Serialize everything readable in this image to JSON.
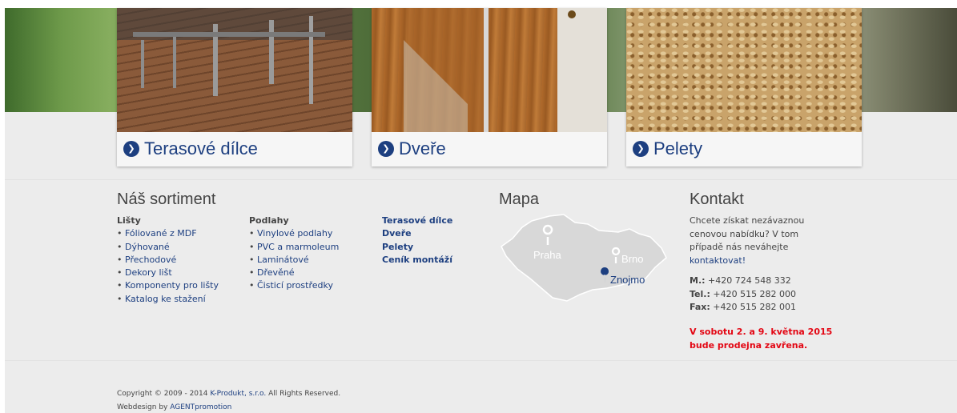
{
  "cards": [
    {
      "title": "Terasové dílce"
    },
    {
      "title": "Dveře"
    },
    {
      "title": "Pelety"
    }
  ],
  "sortiment": {
    "heading": "Náš sortiment",
    "lists_heading": "Lišty",
    "lists": [
      "Fóliované z MDF",
      "Dýhované",
      "Přechodové",
      "Dekory lišt",
      "Komponenty pro lišty",
      "Katalog ke stažení"
    ],
    "floors_heading": "Podlahy",
    "floors": [
      "Vinylové podlahy",
      "PVC a marmoleum",
      "Laminátové",
      "Dřevěné",
      "Čisticí prostředky"
    ],
    "extra": [
      "Terasové dílce",
      "Dveře",
      "Pelety",
      "Ceník montáží"
    ]
  },
  "map": {
    "heading": "Mapa",
    "cities": [
      "Praha",
      "Brno",
      "Znojmo"
    ]
  },
  "contact": {
    "heading": "Kontakt",
    "intro": "Chcete získat nezávaznou cenovou nabídku? V tom případě nás neváhejte",
    "link": "kontaktovat!",
    "mobile_label": "M.:",
    "mobile": "+420 724 548 332",
    "tel_label": "Tel.:",
    "tel": "+420 515 282 000",
    "fax_label": "Fax:",
    "fax": "+420 515 282 001",
    "notice": "V sobotu 2. a 9. května 2015 bude prodejna zavřena."
  },
  "footer": {
    "copy_prefix": "Copyright © 2009 - 2014",
    "company": "K-Produkt, s.r.o.",
    "copy_suffix": "All Rights Reserved.",
    "web_prefix": "Webdesign by",
    "agency": "AGENTpromotion"
  },
  "colors": {
    "link": "#1d3f80",
    "notice": "#e30613",
    "background": "#ececec"
  }
}
